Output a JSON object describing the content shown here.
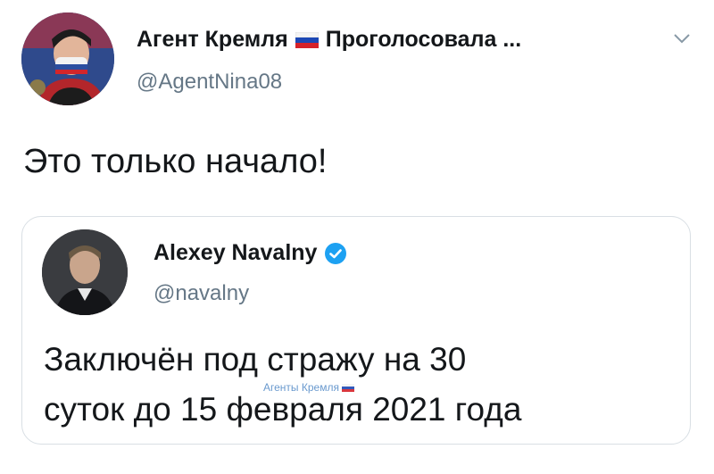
{
  "author": {
    "name": "Агент Кремля",
    "name_suffix": "Проголосовала ...",
    "handle": "@AgentNina08",
    "flag_icon": "russia-flag-icon",
    "avatar_icon": "user-avatar"
  },
  "tweet": {
    "text": "Это только начало!"
  },
  "quoted_tweet": {
    "name": "Alexey Navalny",
    "handle": "@navalny",
    "verified_icon": "verified-badge-icon",
    "text_line_1": "Заключён под стражу на 30",
    "text_line_2": "суток до 15 февраля 2021 года",
    "watermark": "Агенты Кремля"
  },
  "colors": {
    "text_primary": "#14171a",
    "text_secondary": "#657786",
    "verified_blue": "#1da1f2",
    "card_border": "#d9dfe4"
  }
}
